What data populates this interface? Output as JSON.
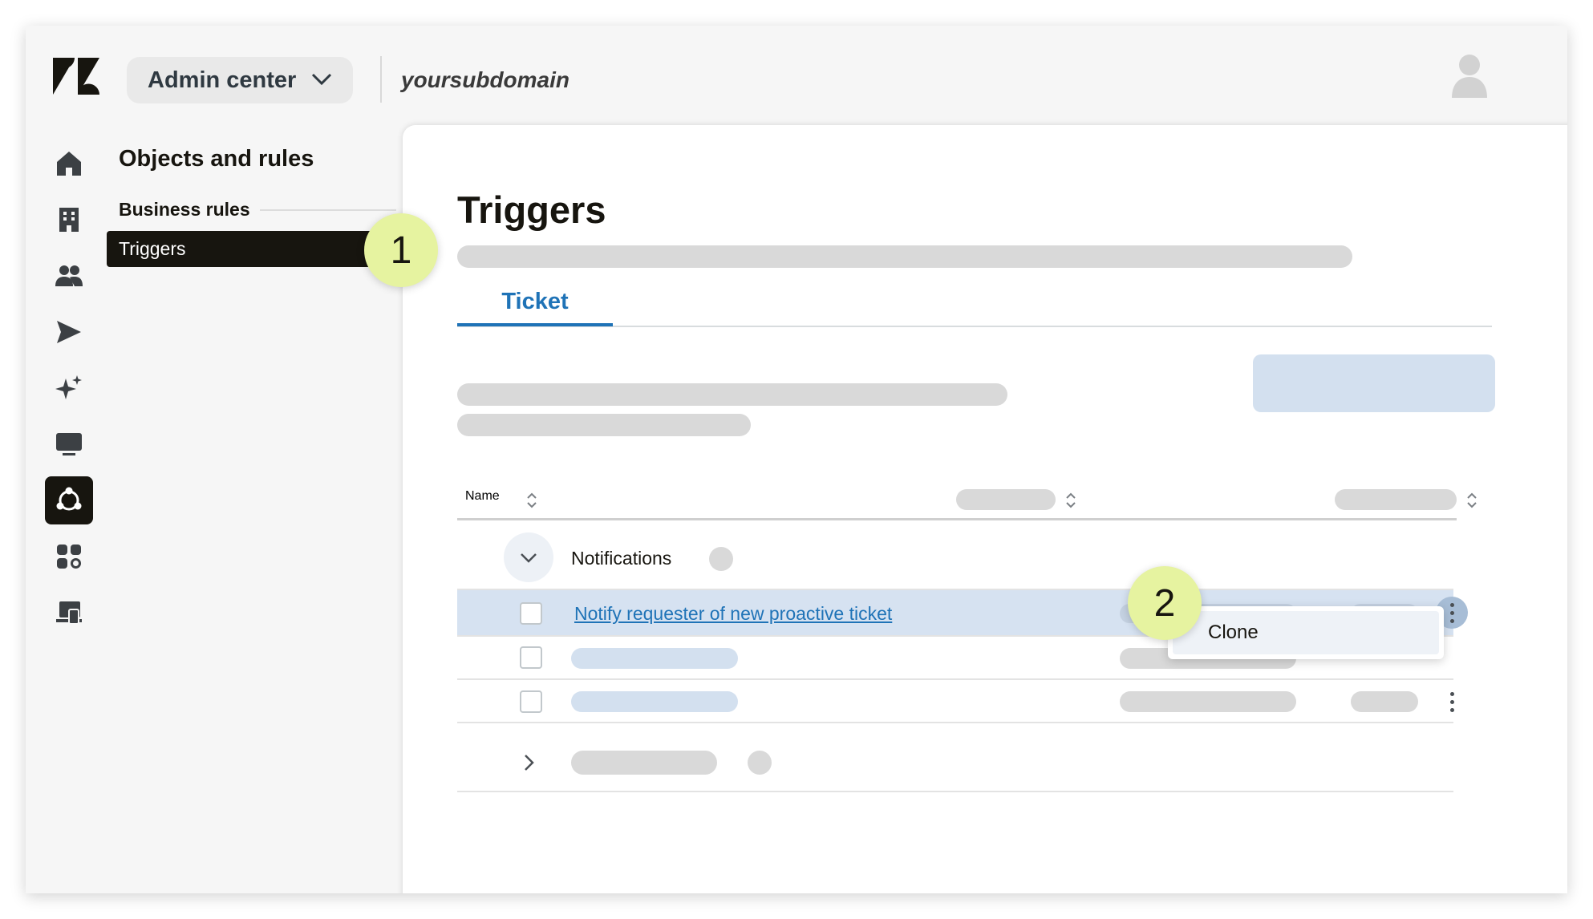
{
  "header": {
    "product_switcher_label": "Admin center",
    "subdomain": "yoursubdomain"
  },
  "rail": {
    "icons": [
      "home-icon",
      "building-icon",
      "people-icon",
      "send-icon",
      "sparkle-icon",
      "workspace-icon",
      "objects-rules-icon",
      "apps-icon",
      "account-icon"
    ],
    "active": "objects-rules-icon"
  },
  "sidebar": {
    "title": "Objects and rules",
    "section": "Business rules",
    "active_item": "Triggers"
  },
  "callouts": {
    "first": "1",
    "second": "2"
  },
  "main": {
    "title": "Triggers",
    "tab": "Ticket",
    "table": {
      "column_name": "Name",
      "group_label": "Notifications",
      "selected_row_link": "Notify requester of new proactive ticket"
    },
    "context_menu": {
      "item": "Clone"
    }
  },
  "colors": {
    "brand_dark": "#17150f",
    "accent_blue": "#1f73b7",
    "callout": "#e6f3a0",
    "placeholder": "#d9d9d9",
    "selected_row": "#d6e2f1"
  }
}
